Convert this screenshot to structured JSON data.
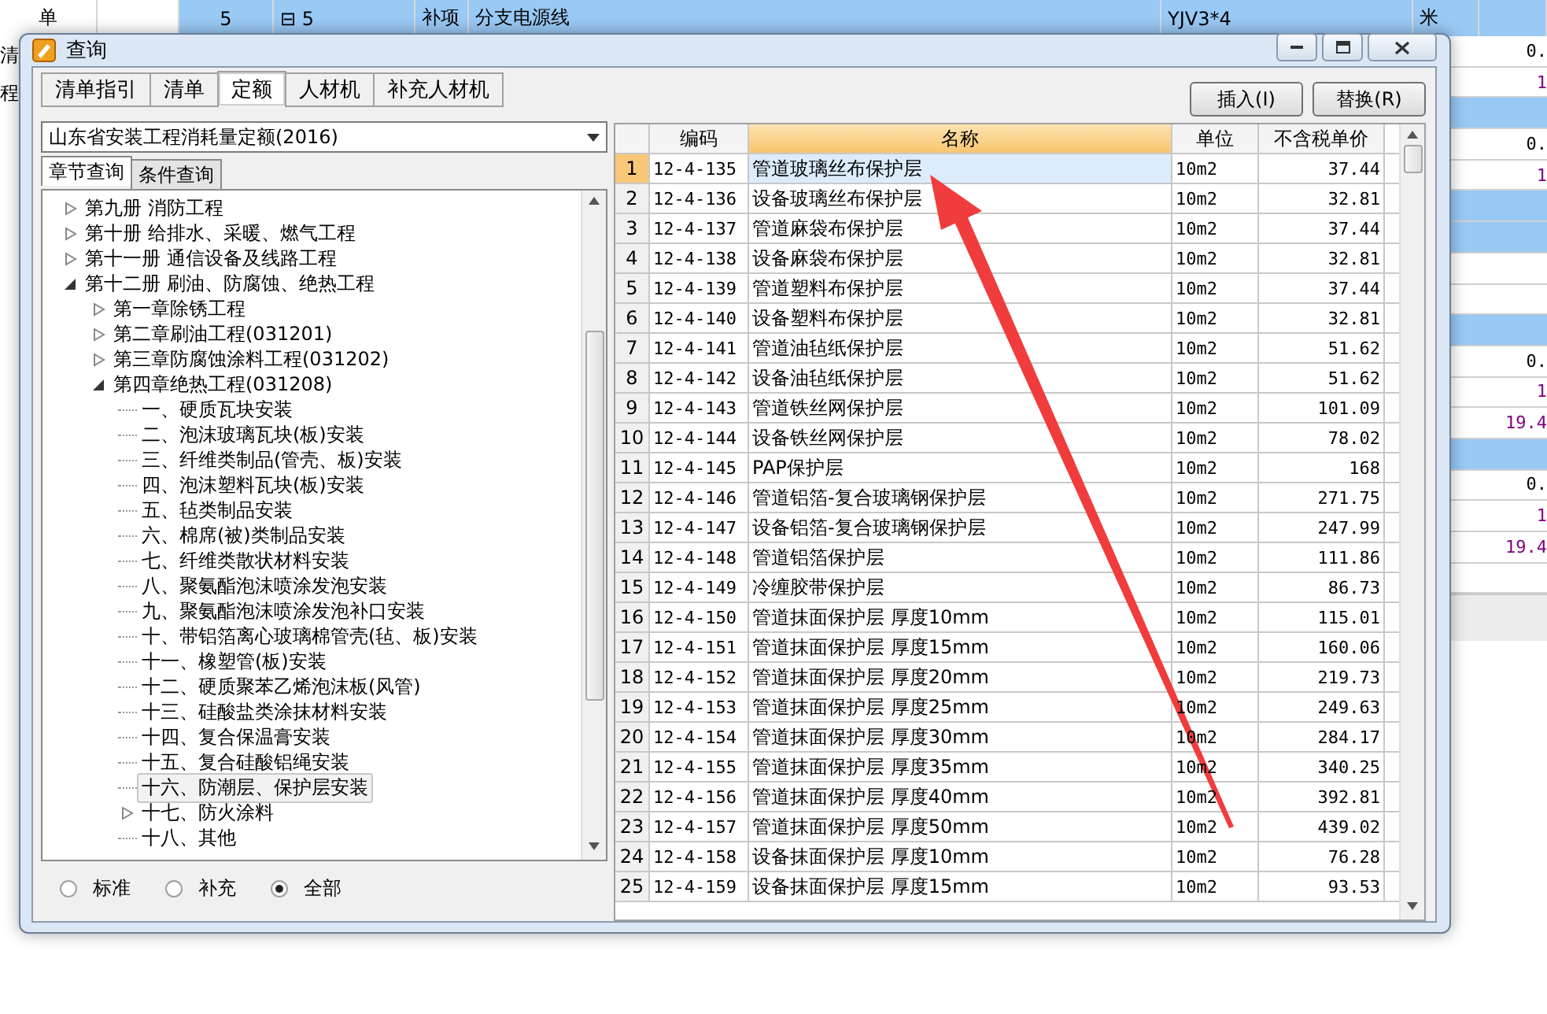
{
  "background": {
    "top_row": {
      "row_number": "5",
      "toggle": "⊟",
      "code": "5",
      "type": "补项",
      "name": "分支电源线",
      "spec": "YJV3*4",
      "unit": "米"
    },
    "left_labels": [
      "单",
      "清",
      "程"
    ],
    "right_cells": [
      {
        "kind": "value",
        "text": "0.",
        "color": "#000000"
      },
      {
        "kind": "value",
        "text": "1",
        "color": "#800080"
      },
      {
        "kind": "band"
      },
      {
        "kind": "value",
        "text": "0.",
        "color": "#000000"
      },
      {
        "kind": "value",
        "text": "1",
        "color": "#800080"
      },
      {
        "kind": "band"
      },
      {
        "kind": "band"
      },
      {
        "kind": "empty"
      },
      {
        "kind": "empty"
      },
      {
        "kind": "band"
      },
      {
        "kind": "value",
        "text": "0.",
        "color": "#000000"
      },
      {
        "kind": "value",
        "text": "1",
        "color": "#800080"
      },
      {
        "kind": "value",
        "text": "19.4",
        "color": "#800080"
      },
      {
        "kind": "band"
      },
      {
        "kind": "value",
        "text": "0.",
        "color": "#000000"
      },
      {
        "kind": "value",
        "text": "1",
        "color": "#800080"
      },
      {
        "kind": "value",
        "text": "19.4",
        "color": "#800080"
      },
      {
        "kind": "empty"
      }
    ]
  },
  "window": {
    "title": "查询"
  },
  "tabs": [
    {
      "label": "清单指引",
      "selected": false
    },
    {
      "label": "清单",
      "selected": false
    },
    {
      "label": "定额",
      "selected": true
    },
    {
      "label": "人材机",
      "selected": false
    },
    {
      "label": "补充人材机",
      "selected": false
    }
  ],
  "buttons": [
    "插入(I)",
    "替换(R)"
  ],
  "library_select": {
    "value": "山东省安装工程消耗量定额(2016)"
  },
  "sub_tabs": [
    {
      "label": "章节查询",
      "selected": true
    },
    {
      "label": "条件查询",
      "selected": false
    }
  ],
  "tree": [
    {
      "label": "第九册 消防工程",
      "expanded": false,
      "selected": false
    },
    {
      "label": "第十册 给排水、采暖、燃气工程",
      "expanded": false,
      "selected": false
    },
    {
      "label": "第十一册 通信设备及线路工程",
      "expanded": false,
      "selected": false
    },
    {
      "label": "第十二册 刷油、防腐蚀、绝热工程",
      "expanded": true,
      "selected": false,
      "children": [
        {
          "label": "第一章除锈工程",
          "expanded": false,
          "selected": false
        },
        {
          "label": "第二章刷油工程(031201)",
          "expanded": false,
          "selected": false
        },
        {
          "label": "第三章防腐蚀涂料工程(031202)",
          "expanded": false,
          "selected": false
        },
        {
          "label": "第四章绝热工程(031208)",
          "expanded": true,
          "selected": false,
          "children": [
            {
              "label": "一、硬质瓦块安装",
              "selected": false
            },
            {
              "label": "二、泡沫玻璃瓦块(板)安装",
              "selected": false
            },
            {
              "label": "三、纤维类制品(管壳、板)安装",
              "selected": false
            },
            {
              "label": "四、泡沫塑料瓦块(板)安装",
              "selected": false
            },
            {
              "label": "五、毡类制品安装",
              "selected": false
            },
            {
              "label": "六、棉席(被)类制品安装",
              "selected": false
            },
            {
              "label": "七、纤维类散状材料安装",
              "selected": false
            },
            {
              "label": "八、聚氨酯泡沫喷涂发泡安装",
              "selected": false
            },
            {
              "label": "九、聚氨酯泡沫喷涂发泡补口安装",
              "selected": false
            },
            {
              "label": "十、带铝箔离心玻璃棉管壳(毡、板)安装",
              "selected": false
            },
            {
              "label": "十一、橡塑管(板)安装",
              "selected": false
            },
            {
              "label": "十二、硬质聚苯乙烯泡沫板(风管)",
              "selected": false
            },
            {
              "label": "十三、硅酸盐类涂抹材料安装",
              "selected": false
            },
            {
              "label": "十四、复合保温膏安装",
              "selected": false
            },
            {
              "label": "十五、复合硅酸铝绳安装",
              "selected": false
            },
            {
              "label": "十六、防潮层、保护层安装",
              "selected": true
            },
            {
              "label": "十七、防火涂料",
              "expanded": false,
              "selected": false
            },
            {
              "label": "十八、其他",
              "selected": false
            }
          ]
        }
      ]
    }
  ],
  "filter_radios": [
    {
      "label": "标准",
      "selected": false
    },
    {
      "label": "补充",
      "selected": false
    },
    {
      "label": "全部",
      "selected": true
    }
  ],
  "table": {
    "columns": [
      "编码",
      "名称",
      "单位",
      "不含税单价"
    ],
    "rows": [
      {
        "n": "1",
        "code": "12-4-135",
        "name": "管道玻璃丝布保护层",
        "unit": "10m2",
        "price": "37.44",
        "selected": true
      },
      {
        "n": "2",
        "code": "12-4-136",
        "name": "设备玻璃丝布保护层",
        "unit": "10m2",
        "price": "32.81",
        "selected": false
      },
      {
        "n": "3",
        "code": "12-4-137",
        "name": "管道麻袋布保护层",
        "unit": "10m2",
        "price": "37.44",
        "selected": false
      },
      {
        "n": "4",
        "code": "12-4-138",
        "name": "设备麻袋布保护层",
        "unit": "10m2",
        "price": "32.81",
        "selected": false
      },
      {
        "n": "5",
        "code": "12-4-139",
        "name": "管道塑料布保护层",
        "unit": "10m2",
        "price": "37.44",
        "selected": false
      },
      {
        "n": "6",
        "code": "12-4-140",
        "name": "设备塑料布保护层",
        "unit": "10m2",
        "price": "32.81",
        "selected": false
      },
      {
        "n": "7",
        "code": "12-4-141",
        "name": "管道油毡纸保护层",
        "unit": "10m2",
        "price": "51.62",
        "selected": false
      },
      {
        "n": "8",
        "code": "12-4-142",
        "name": "设备油毡纸保护层",
        "unit": "10m2",
        "price": "51.62",
        "selected": false
      },
      {
        "n": "9",
        "code": "12-4-143",
        "name": "管道铁丝网保护层",
        "unit": "10m2",
        "price": "101.09",
        "selected": false
      },
      {
        "n": "10",
        "code": "12-4-144",
        "name": "设备铁丝网保护层",
        "unit": "10m2",
        "price": "78.02",
        "selected": false
      },
      {
        "n": "11",
        "code": "12-4-145",
        "name": "PAP保护层",
        "unit": "10m2",
        "price": "168",
        "selected": false
      },
      {
        "n": "12",
        "code": "12-4-146",
        "name": "管道铝箔-复合玻璃钢保护层",
        "unit": "10m2",
        "price": "271.75",
        "selected": false
      },
      {
        "n": "13",
        "code": "12-4-147",
        "name": "设备铝箔-复合玻璃钢保护层",
        "unit": "10m2",
        "price": "247.99",
        "selected": false
      },
      {
        "n": "14",
        "code": "12-4-148",
        "name": "管道铝箔保护层",
        "unit": "10m2",
        "price": "111.86",
        "selected": false
      },
      {
        "n": "15",
        "code": "12-4-149",
        "name": "冷缠胶带保护层",
        "unit": "10m2",
        "price": "86.73",
        "selected": false
      },
      {
        "n": "16",
        "code": "12-4-150",
        "name": "管道抹面保护层 厚度10mm",
        "unit": "10m2",
        "price": "115.01",
        "selected": false
      },
      {
        "n": "17",
        "code": "12-4-151",
        "name": "管道抹面保护层 厚度15mm",
        "unit": "10m2",
        "price": "160.06",
        "selected": false
      },
      {
        "n": "18",
        "code": "12-4-152",
        "name": "管道抹面保护层 厚度20mm",
        "unit": "10m2",
        "price": "219.73",
        "selected": false
      },
      {
        "n": "19",
        "code": "12-4-153",
        "name": "管道抹面保护层 厚度25mm",
        "unit": "10m2",
        "price": "249.63",
        "selected": false
      },
      {
        "n": "20",
        "code": "12-4-154",
        "name": "管道抹面保护层 厚度30mm",
        "unit": "10m2",
        "price": "284.17",
        "selected": false
      },
      {
        "n": "21",
        "code": "12-4-155",
        "name": "管道抹面保护层 厚度35mm",
        "unit": "10m2",
        "price": "340.25",
        "selected": false
      },
      {
        "n": "22",
        "code": "12-4-156",
        "name": "管道抹面保护层 厚度40mm",
        "unit": "10m2",
        "price": "392.81",
        "selected": false
      },
      {
        "n": "23",
        "code": "12-4-157",
        "name": "管道抹面保护层 厚度50mm",
        "unit": "10m2",
        "price": "439.02",
        "selected": false
      },
      {
        "n": "24",
        "code": "12-4-158",
        "name": "设备抹面保护层 厚度10mm",
        "unit": "10m2",
        "price": "76.28",
        "selected": false
      },
      {
        "n": "25",
        "code": "12-4-159",
        "name": "设备抹面保护层 厚度15mm",
        "unit": "10m2",
        "price": "93.53",
        "selected": false
      }
    ]
  }
}
